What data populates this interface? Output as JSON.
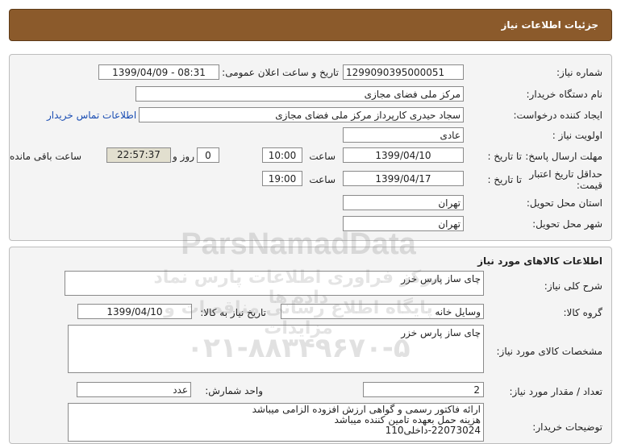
{
  "header": {
    "title": "جزئیات اطلاعات نیاز"
  },
  "info": {
    "need_number_label": "شماره نیاز:",
    "need_number": "1299090395000051",
    "announce_label": "تاریخ و ساعت اعلان عمومی:",
    "announce_value": "1399/04/09 - 08:31",
    "buyer_org_label": "نام دستگاه خریدار:",
    "buyer_org": "مرکز ملی فضای مجازی",
    "requester_label": "ایجاد کننده درخواست:",
    "requester": "سجاد حیدری کارپرداز مرکز ملی فضای مجازی",
    "contact_link": "اطلاعات تماس خریدار",
    "priority_label": "اولویت نیاز :",
    "priority": "عادی",
    "deadline_label": "مهلت ارسال پاسخ:",
    "to_date_label": "تا تاریخ :",
    "deadline_date": "1399/04/10",
    "time_label": "ساعت",
    "deadline_time": "10:00",
    "days_value": "0",
    "days_label": "روز و",
    "remaining_time": "22:57:37",
    "remaining_label": "ساعت باقی مانده",
    "min_validity_label_1": "حداقل تاریخ اعتبار",
    "min_validity_label_2": "قیمت:",
    "validity_to_label": "تا تاریخ :",
    "validity_date": "1399/04/17",
    "validity_time_label": "ساعت",
    "validity_time": "19:00",
    "province_label": "استان محل تحویل:",
    "province": "تهران",
    "city_label": "شهر محل تحویل:",
    "city": "تهران"
  },
  "goods": {
    "section_title": "اطلاعات کالاهای مورد نیاز",
    "summary_label": "شرح کلی نیاز:",
    "summary": "چای ساز پارس خزر",
    "group_label": "گروه کالا:",
    "group": "وسایل خانه",
    "need_date_label": "تاریخ نیاز به کالا:",
    "need_date": "1399/04/10",
    "spec_label": "مشخصات کالای مورد نیاز:",
    "spec": "چای ساز پارس خزر",
    "qty_label": "تعداد / مقدار مورد نیاز:",
    "qty": "2",
    "unit_label": "واحد شمارش:",
    "unit": "عدد",
    "buyer_notes_label": "توضیحات خریدار:",
    "notes_line1": "ارائه فاکتور رسمی و گواهی ارزش افزوده الزامی میباشد",
    "notes_line2": "هزینه حمل بعهده تامین کننده میباشد",
    "notes_line3": "22073024-داخلی110"
  },
  "watermark": {
    "brand": "ParsNamadData",
    "line_fa": "مرکز فراوری اطلاعات پارس نماد داده ها",
    "line_fa2": "پایگاه اطلاع رسانی مناقصات و مزایدات",
    "phone": "۰۲۱-۸۸۳۴۹۶۷۰-۵"
  }
}
